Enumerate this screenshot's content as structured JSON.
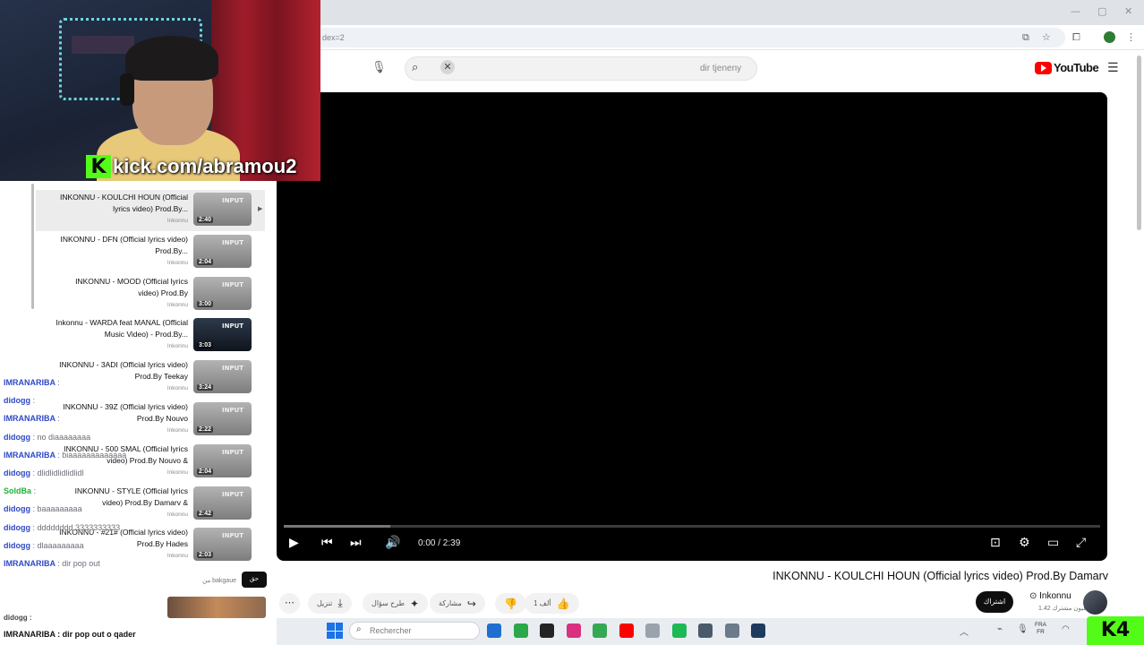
{
  "browser": {
    "url": "dex=2",
    "window_controls": [
      "—",
      "▢",
      "✕"
    ],
    "toolbar_icons": [
      "cast-icon",
      "star-icon",
      "extensions-icon",
      "menu-icon"
    ]
  },
  "webcam": {
    "kick_logo_letter": "K",
    "kick_url": "kick.com/abramou2"
  },
  "youtube": {
    "search_text": "dir tjeneny",
    "search_clear": "✕",
    "logo_text": "YouTube",
    "icons": {
      "mic": "🎙",
      "search": "⌕",
      "menu": "☰"
    }
  },
  "player": {
    "time": "0:00 / 2:39",
    "progress_fraction": 0.0,
    "buffer_fraction": 0.13,
    "controls": {
      "play": "▶",
      "prev": "⏮",
      "next": "⏭",
      "volume": "🔊",
      "subtitles": "⊡",
      "settings": "⚙",
      "theater": "▭",
      "fullscreen": "⤢"
    }
  },
  "video": {
    "title": "INKONNU - KOULCHI HOUN (Official lyrics video) Prod.By Damarv",
    "channel": "⊙ Inkonnu",
    "subscribers": "1.42 مليون مشترك",
    "subscribe_label": "اشتراك",
    "actions": {
      "like": "1 ألف",
      "dislike": "",
      "share": "مشاركة",
      "ask": "طرح سؤال",
      "download": "تنزيل",
      "more": "⋯"
    }
  },
  "playlist": [
    {
      "title": "INKONNU - KOULCHI HOUN (Official lyrics video) Prod.By...",
      "channel": "Inkonnu",
      "duration": "2:40",
      "active": true,
      "dark": false
    },
    {
      "title": "INKONNU - DFN (Official lyrics video) Prod.By...",
      "channel": "Inkonnu",
      "duration": "2:04",
      "active": false,
      "dark": false
    },
    {
      "title": "INKONNU - MOOD (Official lyrics video) Prod.By",
      "channel": "Inkonnu",
      "duration": "3:00",
      "active": false,
      "dark": false
    },
    {
      "title": "Inkonnu - WARDA feat MANAL (Official Music Video) - Prod.By...",
      "channel": "Inkonnu",
      "duration": "3:03",
      "active": false,
      "dark": true
    },
    {
      "title": "INKONNU - 3ADI (Official lyrics video) Prod.By Teekay",
      "channel": "Inkonnu",
      "duration": "3:24",
      "active": false,
      "dark": false
    },
    {
      "title": "INKONNU - 39Z (Official lyrics video) Prod.By Nouvo",
      "channel": "Inkonnu",
      "duration": "2:22",
      "active": false,
      "dark": false
    },
    {
      "title": "INKONNU - 500 SMAL (Official lyrics video) Prod.By Nouvo &",
      "channel": "Inkonnu",
      "duration": "2:04",
      "active": false,
      "dark": false
    },
    {
      "title": "INKONNU - STYLE (Official lyrics video) Prod.By Damarv &",
      "channel": "Inkonnu",
      "duration": "2:42",
      "active": false,
      "dark": false
    },
    {
      "title": "INKONNU - #21# (Official lyrics video) Prod.By Hades",
      "channel": "Inkonnu",
      "duration": "2:03",
      "active": false,
      "dark": false
    }
  ],
  "chat": [
    {
      "user": "IMRANARIBA",
      "message": ":",
      "green": false
    },
    {
      "user": "didogg",
      "message": ":",
      "green": false
    },
    {
      "user": "IMRANARIBA",
      "message": ":",
      "green": false
    },
    {
      "user": "didogg",
      "message": ": no diaaaaaaaa",
      "green": false
    },
    {
      "user": "IMRANARIBA",
      "message": ": biaaaaaaaaaaaaa",
      "green": false
    },
    {
      "user": "didogg",
      "message": ": dlidlidlidlidlidl",
      "green": false
    },
    {
      "user": "SoldBa",
      "message": ":",
      "green": true
    },
    {
      "user": "didogg",
      "message": ": baaaaaaaaa",
      "green": false
    },
    {
      "user": "didogg",
      "message": ": dddddddd 3333333333",
      "green": false
    },
    {
      "user": "didogg",
      "message": ": dlaaaaaaaaa",
      "green": false
    },
    {
      "user": "IMRANARIBA",
      "message": ": dir pop out",
      "green": false
    }
  ],
  "chat_last": "IMRANARIBA : dir pop out o qader",
  "chat_first": "didogg :",
  "comment_preview": "من bakgaue",
  "comment_tag": "حق",
  "taskbar": {
    "search_placeholder": "Rechercher",
    "search_icon": "⌕",
    "lang_top": "FRA",
    "lang_bottom": "FR",
    "kick_corner": "K4",
    "app_colors": [
      "#1f6fd1",
      "#2ba84a",
      "#242424",
      "#d9307f",
      "#34a853",
      "#ff0000",
      "#9aa3ad",
      "#1db954",
      "#4a5a6a",
      "#6b7b8b",
      "#1e3a5f"
    ]
  }
}
